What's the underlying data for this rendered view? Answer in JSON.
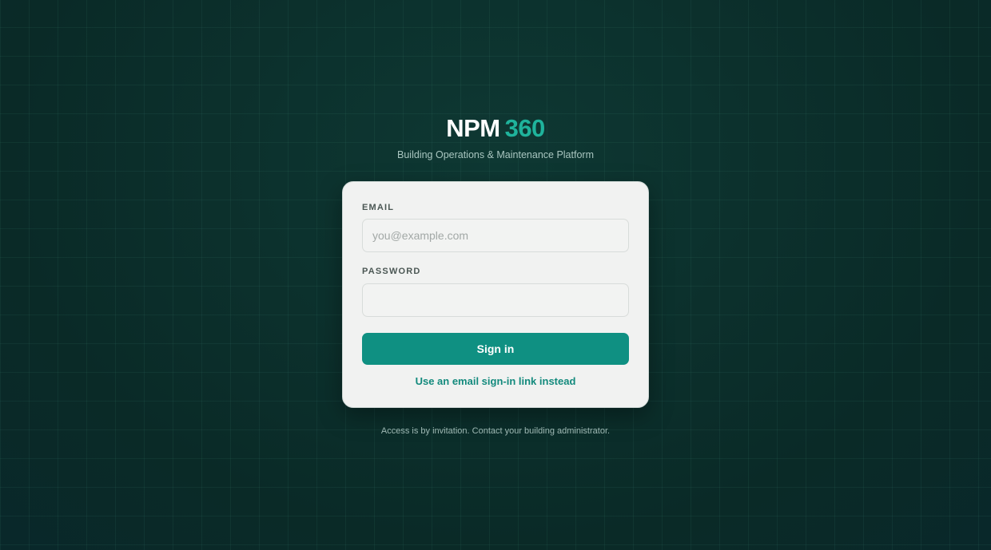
{
  "brand": {
    "name": "NPM",
    "number": "360",
    "tagline": "Building Operations & Maintenance Platform"
  },
  "form": {
    "email_label": "EMAIL",
    "email_placeholder": "you@example.com",
    "email_value": "",
    "password_label": "PASSWORD",
    "password_value": "",
    "submit_label": "Sign in",
    "alt_link": "Use an email sign-in link instead"
  },
  "footer": {
    "note": "Access is by invitation. Contact your building administrator."
  },
  "colors": {
    "background": "#0b2e2a",
    "accent": "#0f9082",
    "brand_number": "#1fb39c",
    "card": "#f1f2f1"
  }
}
